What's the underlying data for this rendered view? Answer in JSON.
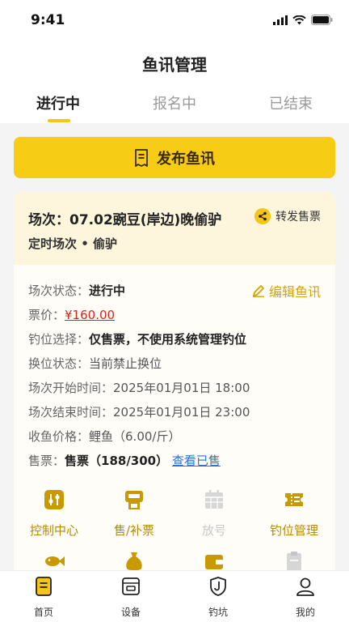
{
  "status_bar": {
    "time": "9:41"
  },
  "header": {
    "title": "鱼讯管理",
    "tabs": [
      {
        "label": "进行中",
        "active": true
      },
      {
        "label": "报名中",
        "active": false
      },
      {
        "label": "已结束",
        "active": false
      }
    ]
  },
  "publish_button": {
    "label": "发布鱼讯",
    "icon": "receipt-icon"
  },
  "card": {
    "title": "场次：07.02豌豆(岸边)晚偷驴",
    "subtitle": "定时场次 • 偷驴",
    "share_label": "转发售票",
    "edit_label": "编辑鱼讯",
    "status_label": "场次状态：",
    "status_value": "进行中",
    "price_label": "票价：",
    "price_value": "¥160.00",
    "spot_label": "钓位选择：",
    "spot_value": "仅售票，不使用系统管理钓位",
    "swap_label": "换位状态：",
    "swap_value": "当前禁止换位",
    "start_label": "场次开始时间：",
    "start_value": "2025年01月01日 18:00",
    "end_label": "场次结束时间：",
    "end_value": "2025年01月01日 23:00",
    "fish_label": "收鱼价格：",
    "fish_value": "鲤鱼（6.00/斤）",
    "sale_label": "售票：",
    "sale_value": "售票（188/300）",
    "sale_link": "查看已售",
    "actions": [
      {
        "label": "控制中心",
        "icon": "control-center-icon",
        "enabled": true
      },
      {
        "label": "售/补票",
        "icon": "ticket-machine-icon",
        "enabled": true
      },
      {
        "label": "放号",
        "icon": "calendar-icon",
        "enabled": false
      },
      {
        "label": "钓位管理",
        "icon": "seat-ticket-icon",
        "enabled": true
      }
    ]
  },
  "tabbar": {
    "items": [
      {
        "label": "首页",
        "icon": "home-doc-icon"
      },
      {
        "label": "设备",
        "icon": "device-icon"
      },
      {
        "label": "钓坑",
        "icon": "fishing-hook-icon"
      },
      {
        "label": "我的",
        "icon": "user-icon"
      }
    ]
  },
  "colors": {
    "accent": "#f7cc15",
    "accent_text": "#b88a00",
    "price": "#e0241c",
    "link": "#2f6fd6"
  }
}
